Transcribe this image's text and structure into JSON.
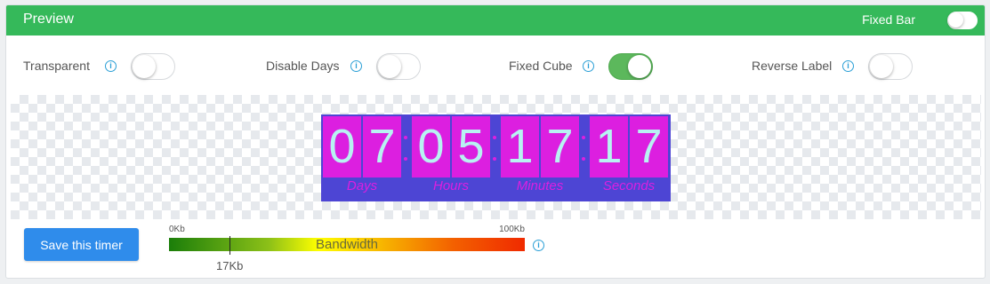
{
  "header": {
    "title": "Preview",
    "fixed_bar_label": "Fixed Bar",
    "fixed_bar_on": false
  },
  "options": [
    {
      "label": "Transparent",
      "on": false
    },
    {
      "label": "Disable Days",
      "on": false
    },
    {
      "label": "Fixed Cube",
      "on": true
    },
    {
      "label": "Reverse Label",
      "on": false
    }
  ],
  "timer": {
    "days": [
      "0",
      "7"
    ],
    "hours": [
      "0",
      "5"
    ],
    "minutes": [
      "1",
      "7"
    ],
    "seconds": [
      "1",
      "7"
    ],
    "labels": {
      "days": "Days",
      "hours": "Hours",
      "minutes": "Minutes",
      "seconds": "Seconds"
    },
    "colors": {
      "background": "#4d45d4",
      "digit_bg": "#dc1fe0",
      "digit_text": "#b8f2f2",
      "label": "#dc1fe0"
    }
  },
  "footer": {
    "save_label": "Save this timer",
    "bandwidth": {
      "title": "Bandwidth",
      "min_label": "0Kb",
      "max_label": "100Kb",
      "current_label": "17Kb",
      "current_fraction": 0.17
    }
  },
  "icons": {
    "info": "info-icon"
  },
  "colors": {
    "header": "#35b95a",
    "toggle_on": "#5cb85c",
    "button": "#2f8ceb",
    "info": "#2a9fd6"
  }
}
